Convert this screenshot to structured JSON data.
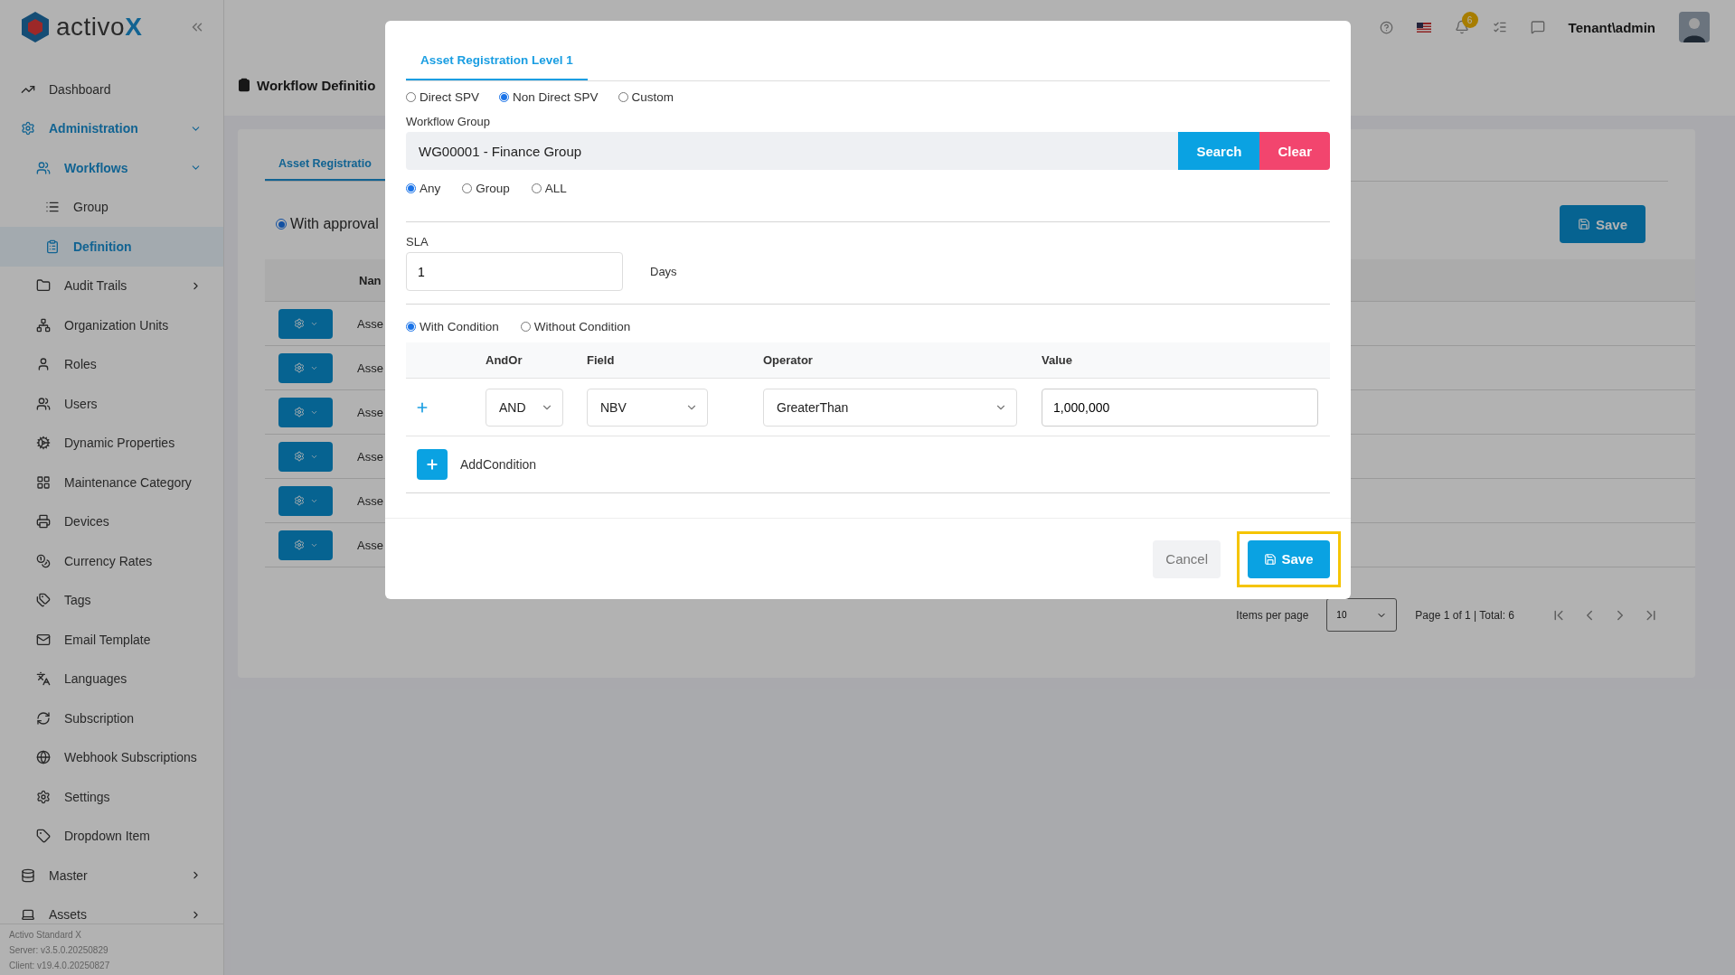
{
  "header": {
    "logo": {
      "name": "activo",
      "mark": "X"
    },
    "notification_count": "6",
    "user": "Tenant\\admin"
  },
  "sidebar": {
    "items": [
      {
        "label": "Dashboard",
        "selected": false
      },
      {
        "label": "Administration",
        "selected": false,
        "expanded": true,
        "children": [
          {
            "label": "Workflows",
            "selected": false,
            "expanded": true,
            "children": [
              {
                "label": "Group",
                "selected": false
              },
              {
                "label": "Definition",
                "selected": true
              }
            ]
          },
          {
            "label": "Audit Trails",
            "selected": false,
            "expanded": false
          },
          {
            "label": "Organization Units",
            "selected": false
          },
          {
            "label": "Roles",
            "selected": false
          },
          {
            "label": "Users",
            "selected": false
          },
          {
            "label": "Dynamic Properties",
            "selected": false
          },
          {
            "label": "Maintenance Category",
            "selected": false
          },
          {
            "label": "Devices",
            "selected": false
          },
          {
            "label": "Currency Rates",
            "selected": false
          },
          {
            "label": "Tags",
            "selected": false
          },
          {
            "label": "Email Template",
            "selected": false
          },
          {
            "label": "Languages",
            "selected": false
          },
          {
            "label": "Subscription",
            "selected": false
          },
          {
            "label": "Webhook Subscriptions",
            "selected": false
          },
          {
            "label": "Settings",
            "selected": false
          },
          {
            "label": "Dropdown Item",
            "selected": false
          }
        ]
      },
      {
        "label": "Master",
        "selected": false,
        "expanded": false
      },
      {
        "label": "Assets",
        "selected": false,
        "expanded": false
      }
    ],
    "footer": [
      "Activo Standard X",
      "Server: v3.5.0.20250829",
      "Client: v19.4.0.20250827"
    ]
  },
  "page": {
    "title": "Workflow Definitio",
    "tab": {
      "label": "Asset Registratio",
      "selected": true
    },
    "approval": {
      "label": "With approval",
      "selected": true
    },
    "save": "Save",
    "table": {
      "columns": [
        "Nan"
      ],
      "rows": [
        {
          "name": "Asse"
        },
        {
          "name": "Asse"
        },
        {
          "name": "Asse"
        },
        {
          "name": "Asse"
        },
        {
          "name": "Asse"
        },
        {
          "name": "Asse"
        }
      ]
    },
    "pagination": {
      "items_label": "Items per page",
      "page_size": "10",
      "summary": "Page 1 of 1 | Total: 6"
    }
  },
  "modal": {
    "tab": {
      "label": "Asset Registration Level 1",
      "selected": true
    },
    "spv_options": [
      {
        "label": "Direct SPV",
        "selected": false
      },
      {
        "label": "Non Direct SPV",
        "selected": true
      },
      {
        "label": "Custom",
        "selected": false
      }
    ],
    "workflow_group": {
      "label": "Workflow Group",
      "value": "WG00001 - Finance Group",
      "search": "Search",
      "clear": "Clear"
    },
    "approver_options": [
      {
        "label": "Any",
        "selected": true
      },
      {
        "label": "Group",
        "selected": false
      },
      {
        "label": "ALL",
        "selected": false
      }
    ],
    "sla": {
      "label": "SLA",
      "value": "1",
      "unit": "Days"
    },
    "condition_options": [
      {
        "label": "With Condition",
        "selected": true
      },
      {
        "label": "Without Condition",
        "selected": false
      }
    ],
    "conditions": {
      "columns": [
        "AndOr",
        "Field",
        "Operator",
        "Value"
      ],
      "rows": [
        {
          "and_or": "AND",
          "field": "NBV",
          "operator": "GreaterThan",
          "value": "1,000,000"
        }
      ]
    },
    "add_condition": "AddCondition",
    "cancel": "Cancel",
    "save": {
      "label": "Save",
      "highlighted": true
    }
  }
}
